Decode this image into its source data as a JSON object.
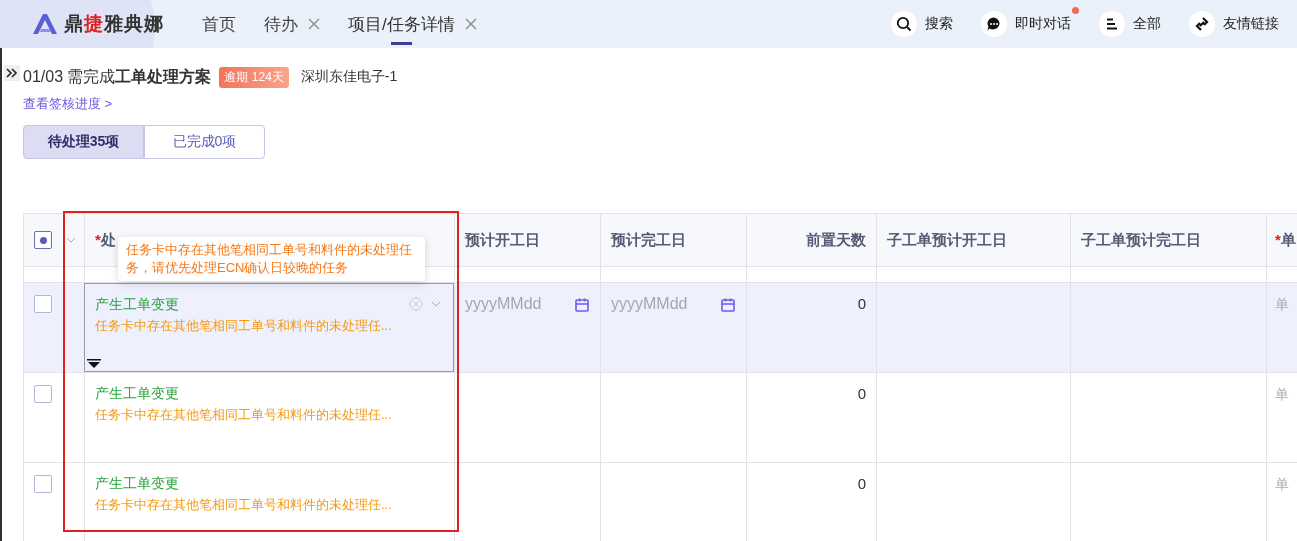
{
  "header": {
    "logo": {
      "prefix": "鼎",
      "accent": "捷",
      "suffix": "雅典娜"
    },
    "tabs": [
      {
        "label": "首页",
        "closable": false,
        "selected": false
      },
      {
        "label": "待办",
        "closable": true,
        "selected": false
      },
      {
        "label": "项目/任务详情",
        "closable": true,
        "selected": true
      }
    ],
    "actions": [
      {
        "kind": "search",
        "label": "搜索",
        "badge": false
      },
      {
        "kind": "chat",
        "label": "即时对话",
        "badge": true
      },
      {
        "kind": "menu",
        "label": "全部",
        "badge": false
      },
      {
        "kind": "link",
        "label": "友情链接",
        "badge": false
      }
    ]
  },
  "task": {
    "heading": "01/03 需完成**工单处理方案**",
    "overdue": "逾期 124天",
    "company": "深圳东佳电子-1",
    "progress_link": "查看签核进度 >"
  },
  "segments": [
    {
      "label": "待处理35项",
      "selected": true
    },
    {
      "label": "已完成0项",
      "selected": false
    }
  ],
  "table": {
    "select_all": {
      "indeterminate": true
    },
    "columns": [
      {
        "required_mark": "*",
        "label": "处"
      },
      {
        "label": "预计开工日"
      },
      {
        "label": "预计完工日"
      },
      {
        "label": "前置天数"
      },
      {
        "label": "子工单预计开工日"
      },
      {
        "label": "子工单预计完工日"
      },
      {
        "required_mark": "*",
        "label": "单"
      }
    ],
    "rows": [
      {
        "selected": true,
        "checked": false,
        "status": "产生工单变更",
        "message": "任务卡中存在其他笔相同工单号和料件的未处理任...",
        "start_placeholder": "yyyyMMdd",
        "end_placeholder": "yyyyMMdd",
        "lead_days": "0",
        "last": "单"
      },
      {
        "selected": false,
        "checked": false,
        "status": "产生工单变更",
        "message": "任务卡中存在其他笔相同工单号和料件的未处理任...",
        "lead_days": "0",
        "last": "单"
      },
      {
        "selected": false,
        "checked": false,
        "status": "产生工单变更",
        "message": "任务卡中存在其他笔相同工单号和料件的未处理任...",
        "lead_days": "0",
        "last": "单"
      }
    ],
    "tooltip": "任务卡中存在其他笔相同工单号和料件的未处理任务，请优先处理ECN确认日较晚的任务"
  }
}
